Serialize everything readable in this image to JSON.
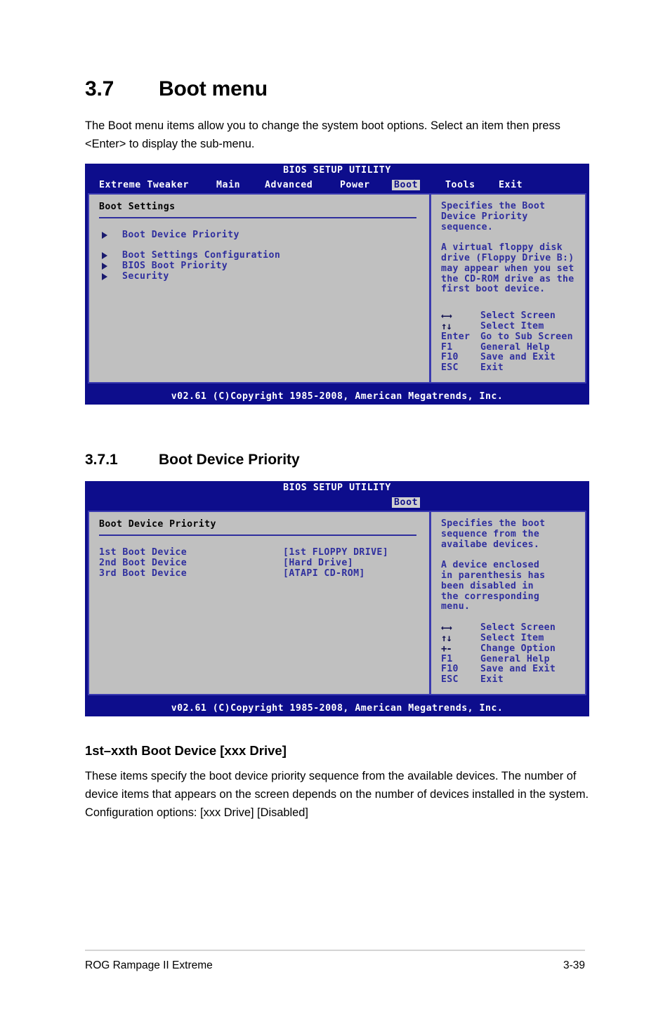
{
  "document": {
    "section_number": "3.7",
    "section_title": "Boot menu",
    "intro_paragraph": "The Boot menu items allow you to change the system boot options. Select an item then press <Enter> to display the sub-menu.",
    "subsection_number": "3.7.1",
    "subsection_title": "Boot Device Priority",
    "item_heading": "1st–xxth Boot Device [xxx Drive]",
    "item_paragraph": "These items specify the boot device priority sequence from the available devices. The number of device items that appears on the screen depends on the number of devices installed in the system. Configuration options: [xxx Drive] [Disabled]",
    "footer_left": "ROG Rampage II Extreme",
    "footer_right": "3-39"
  },
  "bios_main": {
    "title": "BIOS SETUP UTILITY",
    "menu": [
      {
        "label": "Extreme Tweaker",
        "active": false
      },
      {
        "label": "Main",
        "active": false
      },
      {
        "label": "Advanced",
        "active": false
      },
      {
        "label": "Power",
        "active": false
      },
      {
        "label": "Boot",
        "active": true
      },
      {
        "label": "Tools",
        "active": false
      },
      {
        "label": "Exit",
        "active": false
      }
    ],
    "panel_heading": "Boot Settings",
    "nav_items": [
      {
        "label": "Boot Device Priority"
      },
      {
        "label": "Boot Settings Configuration"
      },
      {
        "label": "BIOS Boot Priority"
      },
      {
        "label": "Security"
      }
    ],
    "help_p1": "Specifies the Boot\nDevice Priority\nsequence.",
    "help_p2": "A virtual floppy disk\ndrive (Floppy Drive B:)\nmay appear when you set\nthe CD-ROM drive as the\nfirst boot device.",
    "legend": [
      {
        "key": "←→",
        "glyph": true,
        "desc": "Select Screen"
      },
      {
        "key": "↑↓",
        "glyph": true,
        "desc": "Select Item"
      },
      {
        "key": "Enter",
        "glyph": false,
        "desc": "Go to Sub Screen"
      },
      {
        "key": "F1",
        "glyph": false,
        "desc": "General Help"
      },
      {
        "key": "F10",
        "glyph": false,
        "desc": "Save and Exit"
      },
      {
        "key": "ESC",
        "glyph": false,
        "desc": "Exit"
      }
    ],
    "footer": "v02.61 (C)Copyright 1985-2008, American Megatrends, Inc."
  },
  "bios_bdp": {
    "title": "BIOS SETUP UTILITY",
    "menu": [
      {
        "label": "Boot",
        "active": true
      }
    ],
    "panel_heading": "Boot Device Priority",
    "devices": [
      {
        "label": "1st Boot Device",
        "value": "[1st FLOPPY DRIVE]"
      },
      {
        "label": "2nd Boot Device",
        "value": "[Hard Drive]"
      },
      {
        "label": "3rd Boot Device",
        "value": "[ATAPI CD-ROM]"
      }
    ],
    "help_p1": "Specifies the boot\nsequence from the\navailabe devices.",
    "help_p2": "A device enclosed\nin parenthesis has\nbeen disabled in\nthe corresponding\nmenu.",
    "legend": [
      {
        "key": "←→",
        "glyph": true,
        "desc": "Select Screen"
      },
      {
        "key": "↑↓",
        "glyph": true,
        "desc": "Select Item"
      },
      {
        "key": "+-",
        "glyph": true,
        "desc": "Change Option"
      },
      {
        "key": "F1",
        "glyph": false,
        "desc": "General Help"
      },
      {
        "key": "F10",
        "glyph": false,
        "desc": "Save and Exit"
      },
      {
        "key": "ESC",
        "glyph": false,
        "desc": "Exit"
      }
    ],
    "footer": "v02.61 (C)Copyright 1985-2008, American Megatrends, Inc."
  },
  "colors": {
    "bios_background": "#0d0d8c",
    "bios_panel": "#c0c0c0",
    "bios_text": "#2f2f9e",
    "bios_active_tab_bg": "#d0d0d0"
  }
}
